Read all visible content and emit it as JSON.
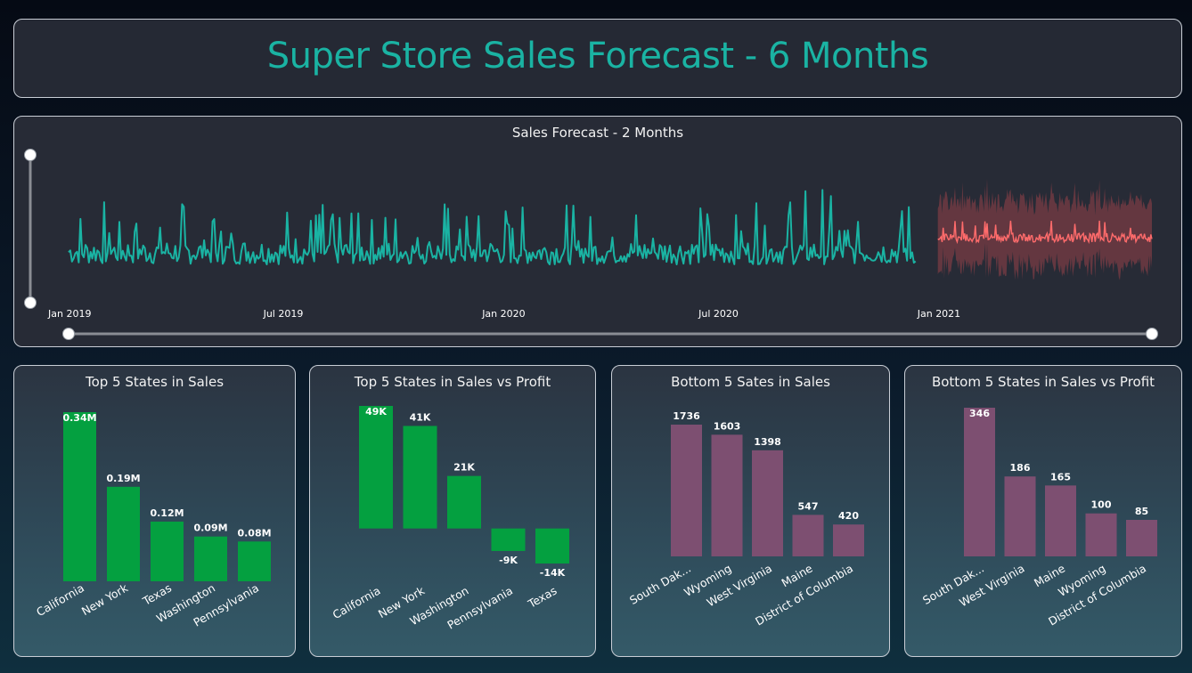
{
  "page": {
    "title": "Super Store Sales Forecast - 6 Months"
  },
  "colors": {
    "accent": "#1ab3a3",
    "forecast": "#ff6b6b",
    "forecast_band": "#7a3c44",
    "positive_bar": "#04a040",
    "bottom_bar": "#7d4f71"
  },
  "chart_data": [
    {
      "id": "forecast",
      "type": "line",
      "title": "Sales Forecast - 2 Months",
      "x_ticks": [
        "Jan 2019",
        "Jul 2019",
        "Jan 2020",
        "Jul 2020",
        "Jan 2021"
      ],
      "x_range": [
        "2019-01-01",
        "2021-06-30"
      ],
      "forecast_start": "2021-01-01",
      "series": [],
      "grid": false,
      "legend": "none"
    },
    {
      "id": "top5-sales",
      "type": "bar",
      "title": "Top 5 States in Sales",
      "categories": [
        "California",
        "New York",
        "Texas",
        "Washington",
        "Pennsylvania"
      ],
      "values": [
        0.34,
        0.19,
        0.12,
        0.09,
        0.08
      ],
      "labels": [
        "0.34M",
        "0.19M",
        "0.12M",
        "0.09M",
        "0.08M"
      ],
      "unit": "M"
    },
    {
      "id": "top5-profit",
      "type": "bar",
      "title": "Top 5 States in Sales vs Profit",
      "categories": [
        "California",
        "New York",
        "Washington",
        "Pennsylvania",
        "Texas"
      ],
      "values": [
        49,
        41,
        21,
        -9,
        -14
      ],
      "labels": [
        "49K",
        "41K",
        "21K",
        "-9K",
        "-14K"
      ],
      "unit": "K"
    },
    {
      "id": "bottom5-sales",
      "type": "bar",
      "title": "Bottom 5 Sates in Sales",
      "categories": [
        "South Dak...",
        "Wyoming",
        "West Virginia",
        "Maine",
        "District of Columbia"
      ],
      "values": [
        1736,
        1603,
        1398,
        547,
        420
      ],
      "labels": [
        "1736",
        "1603",
        "1398",
        "547",
        "420"
      ]
    },
    {
      "id": "bottom5-profit",
      "type": "bar",
      "title": "Bottom 5 States in Sales vs Profit",
      "categories": [
        "South Dak...",
        "West Virginia",
        "Maine",
        "Wyoming",
        "District of Columbia"
      ],
      "values": [
        346,
        186,
        165,
        100,
        85
      ],
      "labels": [
        "346",
        "186",
        "165",
        "100",
        "85"
      ]
    }
  ]
}
